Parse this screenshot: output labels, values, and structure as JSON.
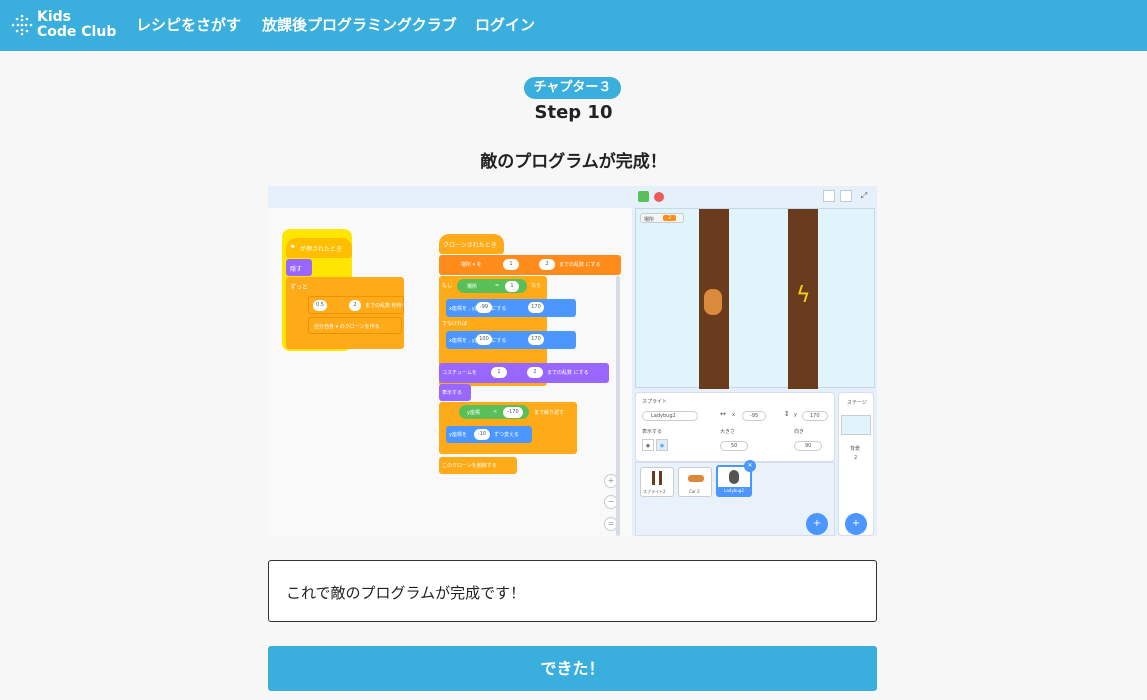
{
  "header": {
    "logo_line1": "Kids",
    "logo_line2": "Code Club",
    "nav": [
      {
        "label": "レシピをさがす"
      },
      {
        "label": "放課後プログラミングクラブ"
      },
      {
        "label": "ログイン"
      }
    ]
  },
  "chapter_badge": "チャプター３",
  "step_label": "Step 10",
  "section_title": "敵のプログラムが完成！",
  "screenshot": {
    "script1": {
      "hat": "が押されたとき",
      "hide": "隠す",
      "forever": "ずっと",
      "wait_from": "0.5",
      "wait_to": "2",
      "wait_suffix": "までの乱数 秒待つ",
      "clone": "自分自身 ▾ のクローンを作る"
    },
    "script2": {
      "hat": "クローンされたとき",
      "set_var": "場所 ▾ を",
      "rand_from": "1",
      "rand_to": "2",
      "rand_suffix": "までの乱数 にする",
      "if_label": "もし",
      "if_var": "場所",
      "if_eq": "=",
      "if_val": "1",
      "if_then": "なら",
      "goto1_x": "-99",
      "goto1_y": "170",
      "goto1_text": "x座標を , y座標を にする",
      "else_label": "でなければ",
      "goto2_x": "100",
      "goto2_y": "170",
      "goto2_text": "x座標を , y座標を にする",
      "costume_label": "コスチュームを",
      "costume_from": "1",
      "costume_to": "2",
      "costume_suffix": "までの乱数 にする",
      "show": "表示する",
      "until_label": "y座標",
      "until_lt": "<",
      "until_val": "-170",
      "until_suffix": "まで繰り返す",
      "change_label": "y座標を",
      "change_val": "-10",
      "change_suffix": "ずつ変える",
      "delete_clone": "このクローンを削除する"
    },
    "stage": {
      "var_label": "場所",
      "var_value": "2"
    },
    "sprite_info": {
      "title": "スプライト",
      "name": "Ladybug2",
      "x_label": "x",
      "x_value": "-95",
      "y_label": "y",
      "y_value": "170",
      "show_label": "表示する",
      "size_label": "大きさ",
      "size_value": "50",
      "dir_label": "向き",
      "dir_value": "90"
    },
    "sprites": [
      {
        "name": "スプライト2"
      },
      {
        "name": "Car 2"
      },
      {
        "name": "Ladybug2"
      }
    ],
    "stage_side": {
      "title": "ステージ",
      "bg_label": "背景",
      "bg_value": "2"
    }
  },
  "message": "これで敵のプログラムが完成です！",
  "done_button": "できた！",
  "colors": {
    "primary": "#3aaedc",
    "scratch_events": "#ffbf00",
    "scratch_control": "#ffab19",
    "scratch_looks": "#9966ff",
    "scratch_motion": "#4c97ff",
    "scratch_variables": "#ff8c1a",
    "scratch_operators": "#59c059"
  }
}
